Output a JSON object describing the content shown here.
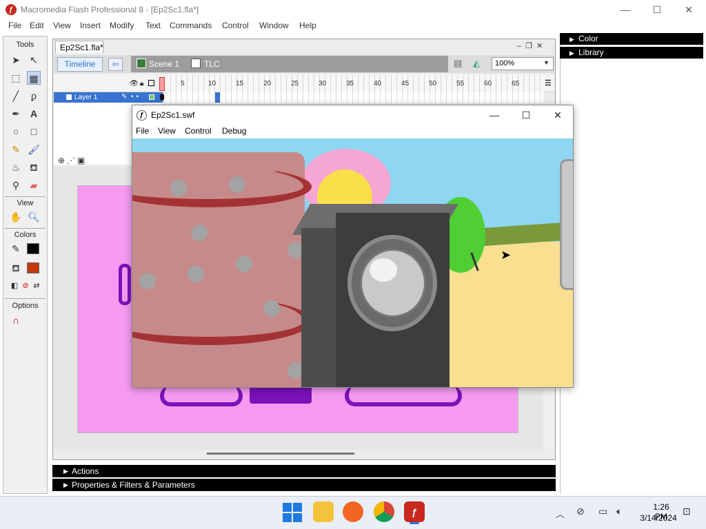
{
  "window": {
    "title": "Macromedia Flash Professional 8 - [Ep2Sc1.fla*]",
    "app_icon": "flash-icon",
    "buttons": [
      "minimize",
      "maximize",
      "close"
    ]
  },
  "menu": [
    "File",
    "Edit",
    "View",
    "Insert",
    "Modify",
    "Text",
    "Commands",
    "Control",
    "Window",
    "Help"
  ],
  "tools": {
    "heading": "Tools",
    "view_heading": "View",
    "colors_heading": "Colors",
    "options_heading": "Options",
    "stroke_color": "#000000",
    "fill_color": "#c23a0c"
  },
  "document": {
    "tab": "Ep2Sc1.fla*",
    "timeline_button": "Timeline",
    "scene": "Scene 1",
    "symbol": "TLC",
    "zoom": "100%"
  },
  "timeline": {
    "frame_numbers": [
      "5",
      "10",
      "15",
      "20",
      "25",
      "30",
      "35",
      "40",
      "45",
      "50",
      "55",
      "60",
      "65"
    ],
    "layers": [
      {
        "name": "Layer 1",
        "selected": true
      }
    ]
  },
  "panels": {
    "actions": "Actions",
    "properties": "Properties & Filters & Parameters",
    "color": "Color",
    "library": "Library"
  },
  "swf_player": {
    "title": "Ep2Sc1.swf",
    "menu": [
      "File",
      "View",
      "Control",
      "Debug"
    ]
  },
  "taskbar": {
    "apps": [
      "start",
      "file-explorer",
      "firefox",
      "chrome",
      "flash"
    ],
    "active_app": "flash",
    "time": "1:26 PM",
    "date": "3/14/2024"
  }
}
